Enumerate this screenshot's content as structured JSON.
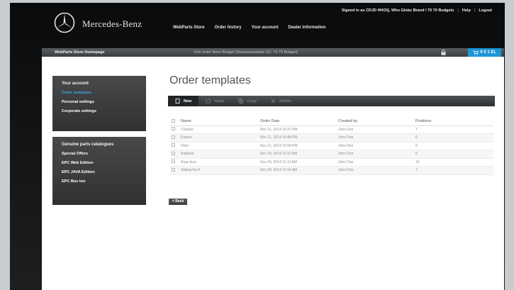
{
  "brand": {
    "name": "Mercedes-Benz"
  },
  "nav": {
    "items": [
      "WebParts Store",
      "Order history",
      "Your account",
      "Dealer information"
    ]
  },
  "utility": {
    "signed_in": "Signed in as CDJD HHOQ, Who Globe Brand / 70 70 Budgets",
    "help": "Help",
    "logout": "Logout"
  },
  "strip": {
    "home": "WebParts Store Homepage",
    "notice": "Ihre order Benz Budget (Bauversandrate 0/2, 70 70 Budget)",
    "cart": "0 0 1 EL"
  },
  "sidebar": {
    "account": {
      "heading": "Your account",
      "items": [
        "Order templates",
        "Personal settings",
        "Corporate settings"
      ]
    },
    "catalogues": {
      "heading": "Genuine parts catalogues",
      "items": [
        "Special Offers",
        "EPC Web Edition",
        "EPC JAVA Edition",
        "EPC Bus too"
      ]
    }
  },
  "main": {
    "title": "Order templates",
    "toolbar": {
      "new": "New",
      "edit": "Open",
      "copy": "Copy",
      "delete": "Delete"
    },
    "columns": [
      "Name",
      "Order Date",
      "Created by",
      "Positions"
    ],
    "rows": [
      {
        "name": "Chassis",
        "date": "Nov 21, 2014 10:37 PM",
        "user": "John Doe",
        "pos": "7"
      },
      {
        "name": "Engine",
        "date": "Nov 21, 2014 10:48 PM",
        "user": "John Doe",
        "pos": "6"
      },
      {
        "name": "Filter",
        "date": "Nov 21, 2014 10:58 PM",
        "user": "John Doe",
        "pos": "5"
      },
      {
        "name": "Radiator",
        "date": "Nov 29, 2014 12:10 AM",
        "user": "John Doe",
        "pos": "6"
      },
      {
        "name": "Rear door",
        "date": "Nov 29, 2014 11:13 AM",
        "user": "John Doe",
        "pos": "16"
      },
      {
        "name": "Sliding Roof",
        "date": "Nov 29, 2014 12:14 AM",
        "user": "John Doe",
        "pos": "7"
      }
    ],
    "back": "< Back"
  },
  "icons": [
    "star-logo-icon",
    "lock-icon",
    "cart-icon",
    "new-document-icon",
    "open-icon",
    "copy-icon",
    "delete-icon"
  ],
  "colors": {
    "accent": "#1b96d6",
    "active_link": "#3ea6dd",
    "dark": "#2f3133"
  }
}
